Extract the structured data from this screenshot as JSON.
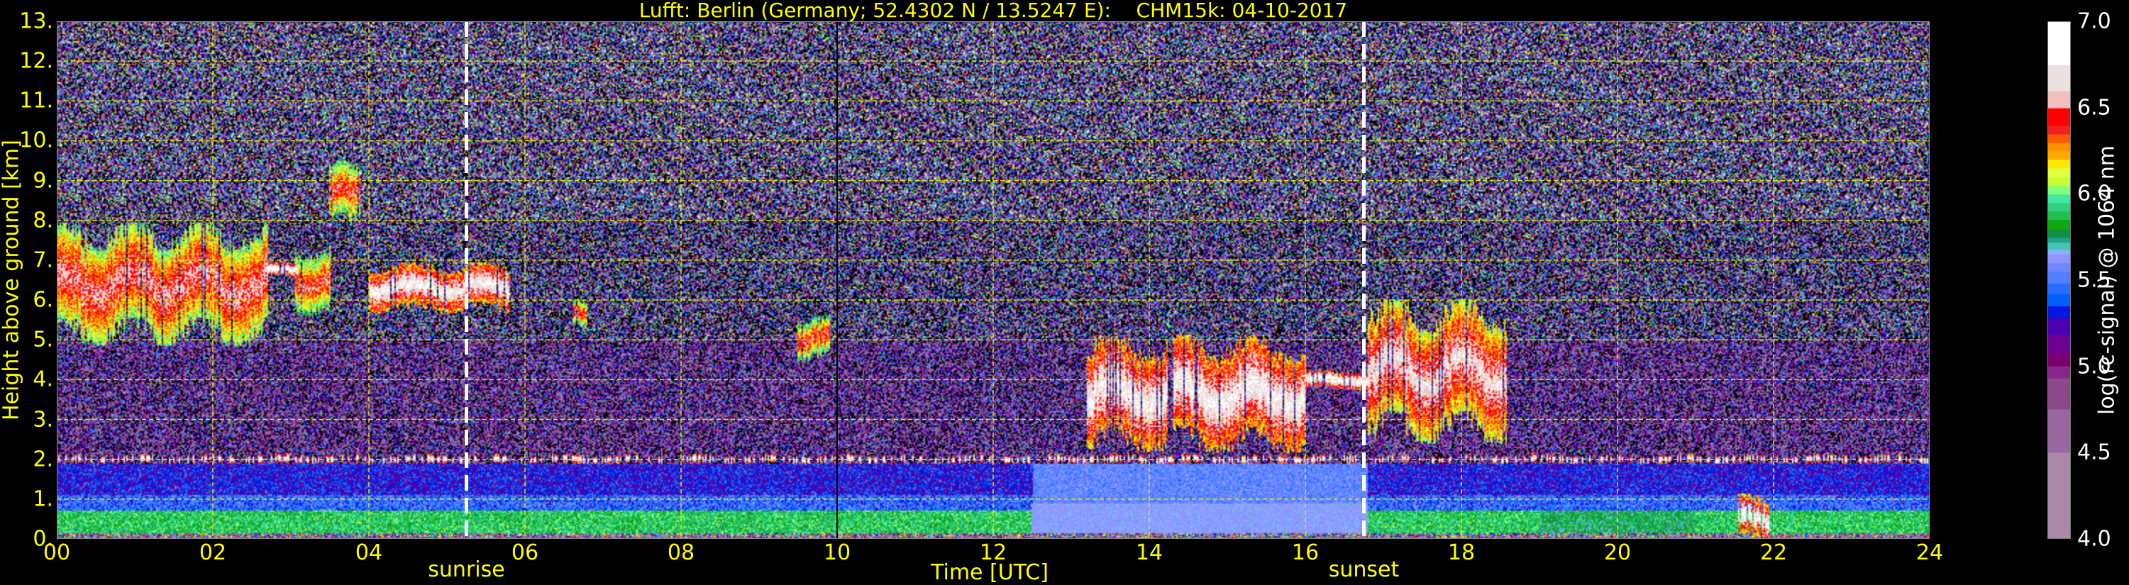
{
  "chart_data": {
    "type": "heatmap",
    "title": "Lufft: Berlin (Germany; 52.4302 N / 13.5247 E):    CHM15k: 04-10-2017",
    "xlabel": "Time [UTC]",
    "ylabel": "Height above ground [km]",
    "xlim": [
      0,
      24
    ],
    "ylim": [
      0,
      13
    ],
    "x_ticks": [
      "00",
      "02",
      "04",
      "06",
      "08",
      "10",
      "12",
      "14",
      "16",
      "18",
      "20",
      "22",
      "24"
    ],
    "y_ticks": [
      "0.",
      "1.",
      "2.",
      "3.",
      "4.",
      "5.",
      "6.",
      "7.",
      "8.",
      "9.",
      "10.",
      "11.",
      "12.",
      "13."
    ],
    "grid": true,
    "colorbar": {
      "label": "log(rc-signal) @ 1064 nm",
      "range": [
        4.0,
        7.0
      ],
      "ticks": [
        "4.0",
        "4.5",
        "5.0",
        "5.5",
        "6.0",
        "6.5",
        "7.0"
      ],
      "colors": [
        [
          4.0,
          "#a88aa8"
        ],
        [
          4.5,
          "#9a68a0"
        ],
        [
          4.75,
          "#8a4a8a"
        ],
        [
          4.93,
          "#85288a"
        ],
        [
          5.0,
          "#7a0070"
        ],
        [
          5.08,
          "#6e0096"
        ],
        [
          5.18,
          "#4a00b0"
        ],
        [
          5.28,
          "#0018e0"
        ],
        [
          5.35,
          "#0060ff"
        ],
        [
          5.42,
          "#2a6cff"
        ],
        [
          5.48,
          "#5080ff"
        ],
        [
          5.55,
          "#7088ff"
        ],
        [
          5.6,
          "#8c96ff"
        ],
        [
          5.65,
          "#88b0ff"
        ],
        [
          5.68,
          "#40c8b0"
        ],
        [
          5.72,
          "#20a090"
        ],
        [
          5.75,
          "#109040"
        ],
        [
          5.8,
          "#10a810"
        ],
        [
          5.85,
          "#20c050"
        ],
        [
          5.9,
          "#30d080"
        ],
        [
          5.95,
          "#40e8a0"
        ],
        [
          6.0,
          "#80ff80"
        ],
        [
          6.05,
          "#c8ff30"
        ],
        [
          6.1,
          "#e0ff40"
        ],
        [
          6.15,
          "#ffe800"
        ],
        [
          6.2,
          "#ffaa00"
        ],
        [
          6.25,
          "#ff9000"
        ],
        [
          6.3,
          "#ff5a00"
        ],
        [
          6.35,
          "#f02020"
        ],
        [
          6.4,
          "#ff0000"
        ],
        [
          6.5,
          "#f0c0c0"
        ],
        [
          6.6,
          "#ece0e0"
        ],
        [
          6.75,
          "#ffffff"
        ]
      ]
    },
    "annotations": [
      {
        "label": "sunrise",
        "time": 5.25
      },
      {
        "label": "sunset",
        "time": 16.75
      }
    ],
    "features": [
      {
        "kind": "cirrus",
        "t": [
          0.0,
          2.7
        ],
        "h": [
          5.2,
          7.6
        ],
        "value": 6.6
      },
      {
        "kind": "cirrus",
        "t": [
          2.7,
          3.1
        ],
        "h": [
          6.6,
          6.9
        ],
        "value": 6.9
      },
      {
        "kind": "cirrus",
        "t": [
          3.05,
          3.5
        ],
        "h": [
          5.8,
          7.2
        ],
        "value": 6.5
      },
      {
        "kind": "cirrus",
        "t": [
          3.5,
          3.9
        ],
        "h": [
          8.0,
          9.3
        ],
        "value": 6.5
      },
      {
        "kind": "cirrus",
        "t": [
          4.0,
          5.8
        ],
        "h": [
          5.8,
          6.8
        ],
        "value": 6.8
      },
      {
        "kind": "cirrus",
        "t": [
          6.6,
          6.8
        ],
        "h": [
          5.4,
          6.0
        ],
        "value": 6.5
      },
      {
        "kind": "cirrus",
        "t": [
          9.5,
          9.9
        ],
        "h": [
          4.6,
          5.5
        ],
        "value": 6.5
      },
      {
        "kind": "cloud",
        "t": [
          13.2,
          16.0
        ],
        "h": [
          2.5,
          4.8
        ],
        "value": 6.8
      },
      {
        "kind": "cloud",
        "t": [
          16.0,
          16.8
        ],
        "h": [
          3.8,
          4.2
        ],
        "value": 6.9
      },
      {
        "kind": "cloud",
        "t": [
          16.8,
          18.6
        ],
        "h": [
          2.8,
          5.6
        ],
        "value": 6.7
      },
      {
        "kind": "precipitation",
        "t": [
          21.55,
          21.95
        ],
        "h": [
          0.0,
          1.0
        ],
        "value": 6.8
      },
      {
        "kind": "boundary-layer-top",
        "t": [
          0,
          24
        ],
        "h": [
          1.9,
          2.1
        ],
        "value": 6.9
      }
    ]
  }
}
